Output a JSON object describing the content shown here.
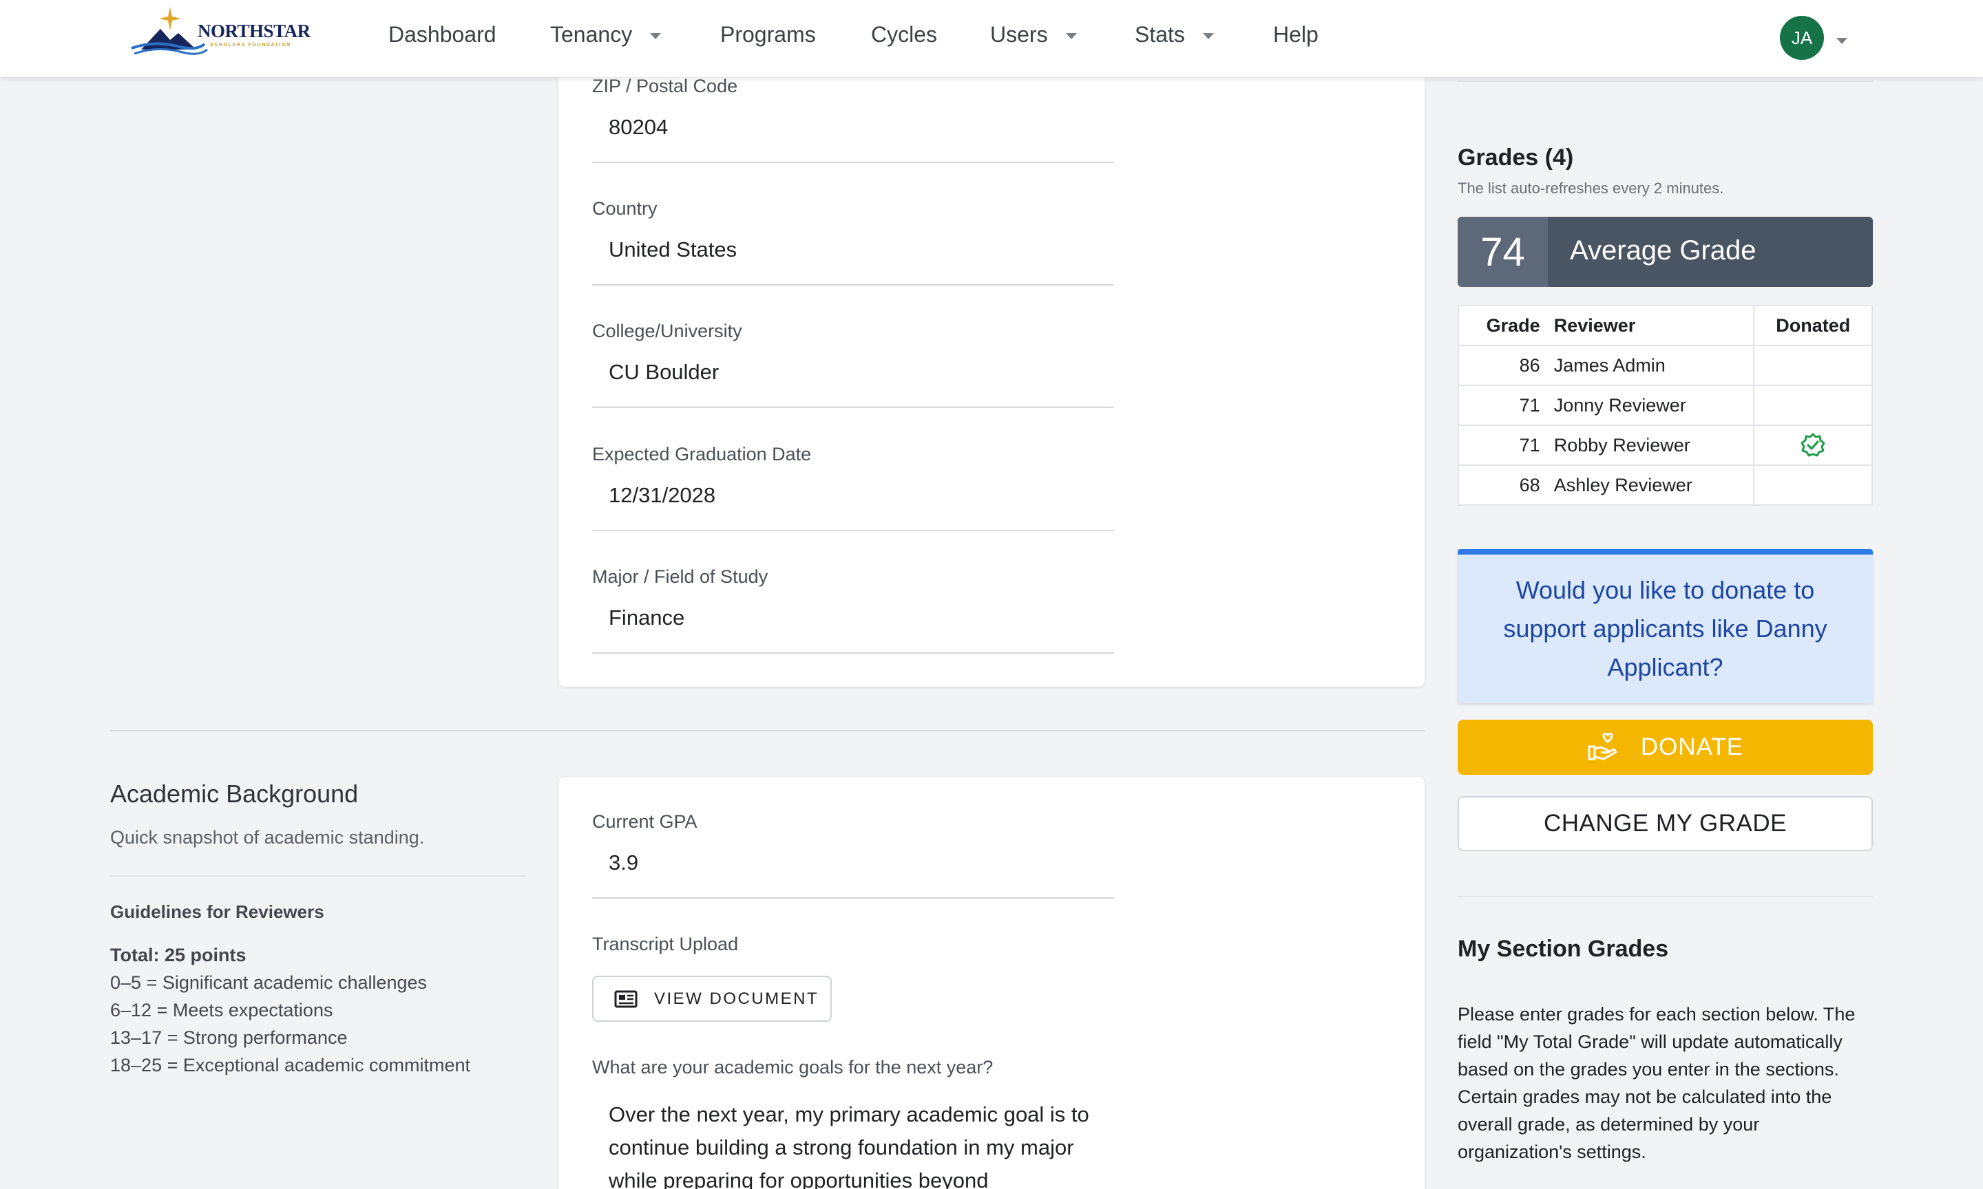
{
  "nav": {
    "logo_text": "NORTHSTAR",
    "logo_sub": "SCHOLARS FOUNDATION",
    "items": [
      {
        "label": "Dashboard"
      },
      {
        "label": "Tenancy"
      },
      {
        "label": "Programs"
      },
      {
        "label": "Cycles"
      },
      {
        "label": "Users"
      },
      {
        "label": "Stats"
      },
      {
        "label": "Help"
      }
    ],
    "avatar_initials": "JA"
  },
  "profile_fields": [
    {
      "label": "ZIP / Postal Code",
      "value": "80204"
    },
    {
      "label": "Country",
      "value": "United States"
    },
    {
      "label": "College/University",
      "value": "CU Boulder"
    },
    {
      "label": "Expected Graduation Date",
      "value": "12/31/2028"
    },
    {
      "label": "Major / Field of Study",
      "value": "Finance"
    }
  ],
  "academic": {
    "title": "Academic Background",
    "subtitle": "Quick snapshot of academic standing.",
    "guidelines_title": "Guidelines for Reviewers",
    "total": "Total: 25 points",
    "lines": [
      "0–5 = Significant academic challenges",
      "6–12 = Meets expectations",
      "13–17 = Strong performance",
      "18–25 = Exceptional academic commitment"
    ],
    "gpa_label": "Current GPA",
    "gpa_value": "3.9",
    "transcript_label": "Transcript Upload",
    "view_document": "VIEW DOCUMENT",
    "goals_label": "What are your academic goals for the next year?",
    "goals_text": "Over the next year, my primary academic goal is to continue building a strong foundation in my major while preparing for opportunities beyond"
  },
  "grades": {
    "title": "Grades (4)",
    "subtitle": "The list auto-refreshes every 2 minutes.",
    "average": "74",
    "average_label": "Average Grade",
    "headers": {
      "grade": "Grade",
      "reviewer": "Reviewer",
      "donated": "Donated"
    },
    "rows": [
      {
        "grade": "86",
        "reviewer": "James Admin",
        "donated": false
      },
      {
        "grade": "71",
        "reviewer": "Jonny Reviewer",
        "donated": false
      },
      {
        "grade": "71",
        "reviewer": "Robby Reviewer",
        "donated": true
      },
      {
        "grade": "68",
        "reviewer": "Ashley Reviewer",
        "donated": false
      }
    ]
  },
  "donate": {
    "callout": "Would you like to donate to support applicants like Danny Applicant?",
    "button": "DONATE",
    "change_grade": "CHANGE MY GRADE"
  },
  "section_grades": {
    "title": "My Section Grades",
    "text": "Please enter grades for each section below. The field \"My Total Grade\" will update automatically based on the grades you enter in the sections. Certain grades may not be calculated into the overall grade, as determined by your organization's settings."
  },
  "colors": {
    "accent_green": "#157347",
    "donate_yellow": "#f5b600",
    "avg_box": "#4a5563",
    "callout_blue": "#dbe9fb",
    "callout_border": "#2f7ae5",
    "verified_green": "#1e9e4a"
  }
}
